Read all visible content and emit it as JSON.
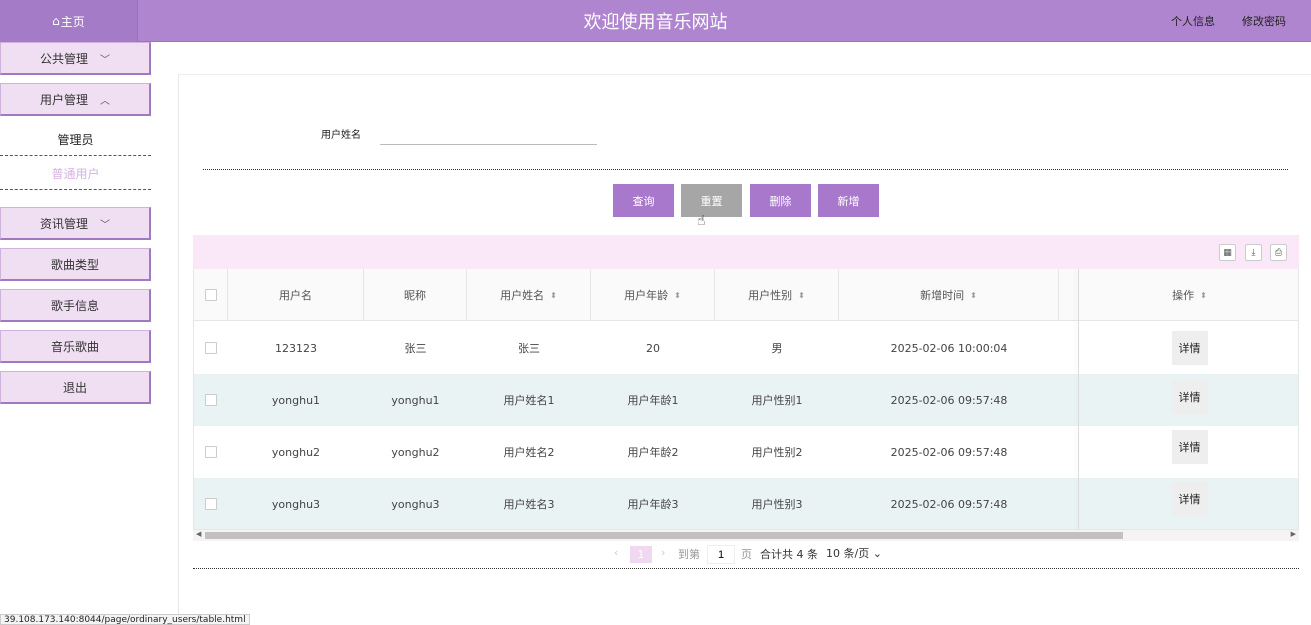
{
  "header": {
    "home_icon": "home-icon",
    "home_label": "主页",
    "title": "欢迎使用音乐网站",
    "profile_link": "个人信息",
    "password_link": "修改密码"
  },
  "sidebar": {
    "items": [
      {
        "label": "公共管理",
        "chevron": "chevron-down-icon"
      },
      {
        "label": "用户管理",
        "chevron": "chevron-up-icon",
        "expanded": true,
        "children": [
          {
            "label": "管理员"
          },
          {
            "label": "普通用户",
            "active": true
          }
        ]
      },
      {
        "label": "资讯管理",
        "chevron": "chevron-down-icon"
      },
      {
        "label": "歌曲类型"
      },
      {
        "label": "歌手信息"
      },
      {
        "label": "音乐歌曲"
      },
      {
        "label": "退出"
      }
    ]
  },
  "search": {
    "label": "用户姓名",
    "value": ""
  },
  "buttons": {
    "query": "查询",
    "reset": "重置",
    "delete": "删除",
    "add": "新增"
  },
  "colors": {
    "header": "#b085cf",
    "button_purple": "#a878cc",
    "button_gray": "#a6a6a6",
    "toolbar_bg": "#fae8f9",
    "row_alt": "#eaf3f4"
  },
  "toolbar_icons": [
    "columns-icon",
    "export-icon",
    "print-icon"
  ],
  "table": {
    "columns": [
      "用户名",
      "昵称",
      "用户姓名",
      "用户年龄",
      "用户性别",
      "新增时间",
      "操作"
    ],
    "sortable": [
      false,
      false,
      true,
      true,
      true,
      true,
      true
    ],
    "rows": [
      {
        "username": "123123",
        "nickname": "张三",
        "name": "张三",
        "age": "20",
        "gender": "男",
        "created": "2025-02-06 10:00:04",
        "action": "详情"
      },
      {
        "username": "yonghu1",
        "nickname": "yonghu1",
        "name": "用户姓名1",
        "age": "用户年龄1",
        "gender": "用户性别1",
        "created": "2025-02-06 09:57:48",
        "action": "详情"
      },
      {
        "username": "yonghu2",
        "nickname": "yonghu2",
        "name": "用户姓名2",
        "age": "用户年龄2",
        "gender": "用户性别2",
        "created": "2025-02-06 09:57:48",
        "action": "详情"
      },
      {
        "username": "yonghu3",
        "nickname": "yonghu3",
        "name": "用户姓名3",
        "age": "用户年龄3",
        "gender": "用户性别3",
        "created": "2025-02-06 09:57:48",
        "action": "详情"
      }
    ]
  },
  "pager": {
    "prev": "‹",
    "current": "1",
    "next": "›",
    "goto_label": "到第",
    "goto_value": "1",
    "page_unit": "页",
    "total": "合计共 4 条",
    "page_size": "10 条/页"
  },
  "status_url": "39.108.173.140:8044/page/ordinary_users/table.html"
}
